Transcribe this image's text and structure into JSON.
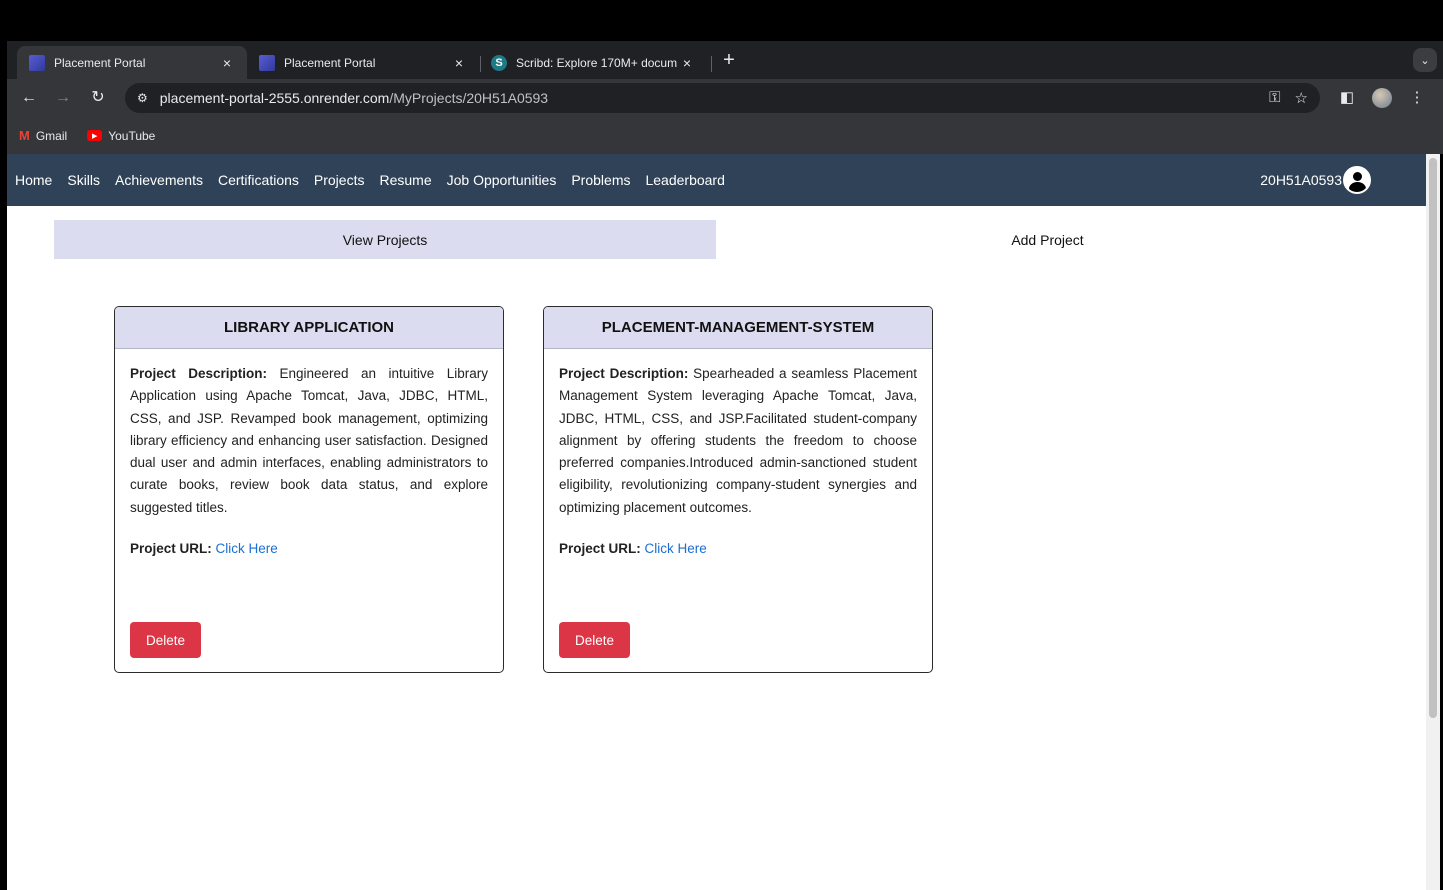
{
  "browser": {
    "tabs": [
      {
        "title": "Placement Portal",
        "favicon": "portal-icon",
        "active": true
      },
      {
        "title": "Placement Portal",
        "favicon": "portal-icon",
        "active": false
      },
      {
        "title": "Scribd: Explore 170M+ docum",
        "favicon": "scribd-icon",
        "active": false
      }
    ],
    "close_glyph": "×",
    "new_tab_glyph": "+",
    "tab_list_glyph": "⌄",
    "address": {
      "host": "placement-portal-2555.onrender.com",
      "path": "/MyProjects/20H51A0593"
    },
    "bookmarks": [
      {
        "label": "Gmail",
        "icon": "gmail-icon"
      },
      {
        "label": "YouTube",
        "icon": "youtube-icon"
      }
    ]
  },
  "nav": {
    "links": [
      "Home",
      "Skills",
      "Achievements",
      "Certifications",
      "Projects",
      "Resume",
      "Job Opportunities",
      "Problems",
      "Leaderboard"
    ],
    "user_id": "20H51A0593"
  },
  "subtabs": {
    "view": "View Projects",
    "add": "Add Project"
  },
  "projects": [
    {
      "title": "LIBRARY APPLICATION",
      "desc_label": "Project Description:",
      "description": "Engineered an intuitive Library Application using Apache Tomcat, Java, JDBC, HTML, CSS, and JSP. Revamped book management, optimizing library efficiency and enhancing user satisfaction. Designed dual user and admin interfaces, enabling administrators to curate books, review book data status, and explore suggested titles.",
      "url_label": "Project URL:",
      "url_text": "Click Here",
      "delete_label": "Delete"
    },
    {
      "title": "PLACEMENT-MANAGEMENT-SYSTEM",
      "desc_label": "Project Description:",
      "description": "Spearheaded a seamless Placement Management System leveraging Apache Tomcat, Java, JDBC, HTML, CSS, and JSP.Facilitated student-company alignment by offering students the freedom to choose preferred companies.Introduced admin-sanctioned student eligibility, revolutionizing company-student synergies and optimizing placement outcomes.",
      "url_label": "Project URL:",
      "url_text": "Click Here",
      "delete_label": "Delete"
    }
  ],
  "colors": {
    "navbar": "#2f4258",
    "accent_tab": "#dcdcf0",
    "delete": "#dc3545",
    "link": "#1a6fd1"
  }
}
